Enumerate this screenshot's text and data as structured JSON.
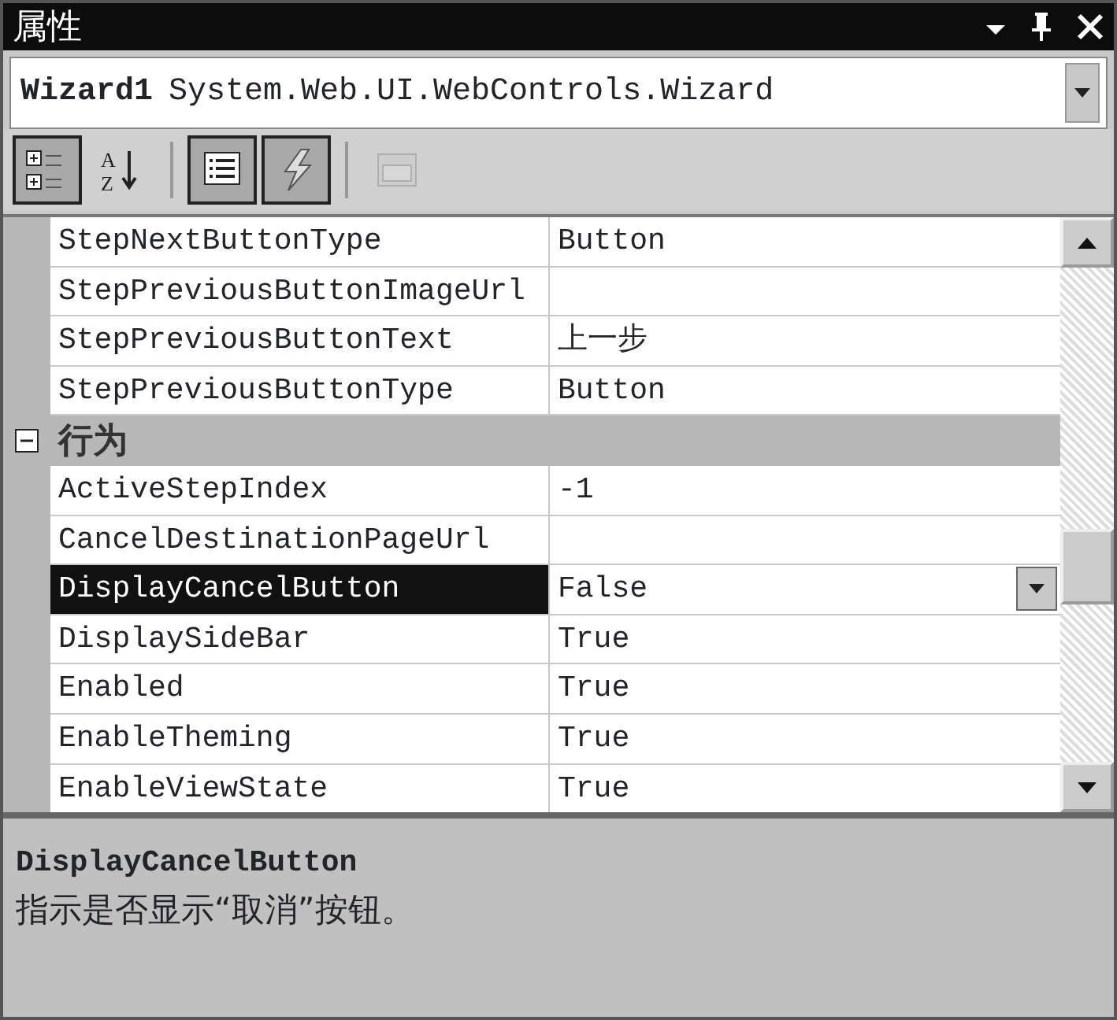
{
  "window": {
    "title": "属性"
  },
  "object_selector": {
    "name": "Wizard1",
    "type": "System.Web.UI.WebControls.Wizard"
  },
  "toolbar": [
    {
      "kind": "categorized",
      "pressed": true
    },
    {
      "kind": "alphabetical",
      "pressed": false,
      "letters": [
        "A",
        "Z"
      ]
    },
    {
      "kind": "separator"
    },
    {
      "kind": "properties",
      "pressed": true
    },
    {
      "kind": "events",
      "pressed": true
    },
    {
      "kind": "separator"
    },
    {
      "kind": "property-pages",
      "pressed": false,
      "disabled": true
    }
  ],
  "rows": [
    {
      "kind": "property",
      "name": "StepNextButtonType",
      "value": "Button",
      "selected": false
    },
    {
      "kind": "property",
      "name": "StepPreviousButtonImageUrl",
      "value": "",
      "selected": false
    },
    {
      "kind": "property",
      "name": "StepPreviousButtonText",
      "value": "上一步",
      "selected": false
    },
    {
      "kind": "property",
      "name": "StepPreviousButtonType",
      "value": "Button",
      "selected": false
    },
    {
      "kind": "category",
      "label": "行为",
      "expanded": true
    },
    {
      "kind": "property",
      "name": "ActiveStepIndex",
      "value": "-1",
      "selected": false
    },
    {
      "kind": "property",
      "name": "CancelDestinationPageUrl",
      "value": "",
      "selected": false
    },
    {
      "kind": "property",
      "name": "DisplayCancelButton",
      "value": "False",
      "selected": true
    },
    {
      "kind": "property",
      "name": "DisplaySideBar",
      "value": "True",
      "selected": false
    },
    {
      "kind": "property",
      "name": "Enabled",
      "value": "True",
      "selected": false
    },
    {
      "kind": "property",
      "name": "EnableTheming",
      "value": "True",
      "selected": false
    },
    {
      "kind": "property",
      "name": "EnableViewState",
      "value": "True",
      "selected": false
    }
  ],
  "description": {
    "title": "DisplayCancelButton",
    "text": "指示是否显示“取消”按钮。"
  }
}
